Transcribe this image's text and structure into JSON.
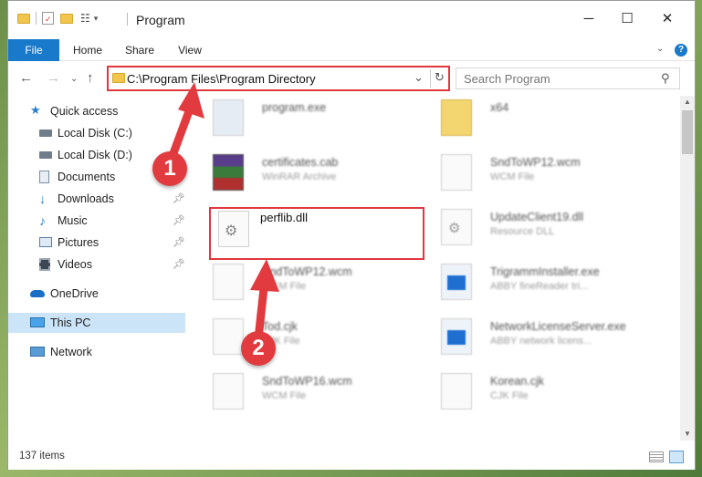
{
  "window": {
    "title": "Program",
    "controls": {
      "minimize": "─",
      "maximize": "☐",
      "close": "✕"
    }
  },
  "ribbon": {
    "tabs": [
      "File",
      "Home",
      "Share",
      "View"
    ],
    "help": "?"
  },
  "address": {
    "path": "C:\\Program Files\\Program Directory"
  },
  "search": {
    "placeholder": "Search Program"
  },
  "sidebar": {
    "items": [
      {
        "label": "Quick access",
        "icon": "star-icon"
      },
      {
        "label": "Local Disk (C:)",
        "icon": "drive-icon"
      },
      {
        "label": "Local Disk (D:)",
        "icon": "drive-icon"
      },
      {
        "label": "Documents",
        "icon": "documents-icon"
      },
      {
        "label": "Downloads",
        "icon": "downloads-icon",
        "pinned": true
      },
      {
        "label": "Music",
        "icon": "music-icon",
        "pinned": true
      },
      {
        "label": "Pictures",
        "icon": "pictures-icon",
        "pinned": true
      },
      {
        "label": "Videos",
        "icon": "videos-icon",
        "pinned": true
      },
      {
        "label": "OneDrive",
        "icon": "cloud-icon"
      },
      {
        "label": "This PC",
        "icon": "computer-icon",
        "selected": true
      },
      {
        "label": "Network",
        "icon": "network-icon"
      }
    ]
  },
  "files": [
    {
      "name": "program.exe",
      "type": ""
    },
    {
      "name": "x64",
      "type": ""
    },
    {
      "name": "certificates.cab",
      "type": "WinRAR Archive"
    },
    {
      "name": "SndToWP12.wcm",
      "type": "WCM File"
    },
    {
      "name": "perflib.dll",
      "type": ""
    },
    {
      "name": "UpdateClient19.dll",
      "type": "Resource DLL"
    },
    {
      "name": "SndToWP12.wcm",
      "type": "WCM File"
    },
    {
      "name": "TrigrammInstaller.exe",
      "type": "ABBY fineReader tri..."
    },
    {
      "name": "Tod.cjk",
      "type": "CJK File"
    },
    {
      "name": "NetworkLicenseServer.exe",
      "type": "ABBY network licens..."
    },
    {
      "name": "SndToWP16.wcm",
      "type": "WCM File"
    },
    {
      "name": "Korean.cjk",
      "type": "CJK File"
    }
  ],
  "status": {
    "count": "137 items"
  },
  "callouts": [
    "1",
    "2"
  ],
  "colors": {
    "accent": "#1979ca",
    "highlight": "#e0383e",
    "selected": "#cce4f7"
  }
}
